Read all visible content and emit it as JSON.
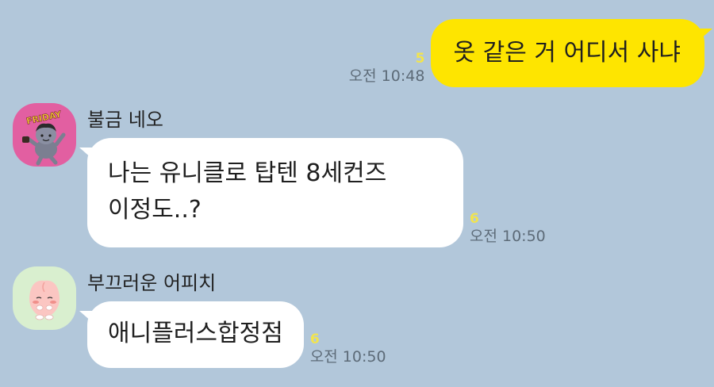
{
  "messages": [
    {
      "direction": "sent",
      "text": "옷 같은 거 어디서 사냐",
      "unread": "5",
      "time": "오전 10:48"
    },
    {
      "direction": "received",
      "sender": "불금 네오",
      "avatar": "neo-friday-avatar-icon",
      "lines": [
        "나는 유니클로 탑텐 8세컨즈",
        "이정도..?"
      ],
      "unread": "6",
      "time": "오전 10:50"
    },
    {
      "direction": "received",
      "sender": "부끄러운 어피치",
      "avatar": "apeach-avatar-icon",
      "text": "애니플러스합정점",
      "unread": "6",
      "time": "오전 10:50"
    }
  ],
  "avatar_labels": {
    "friday": "FRIDAY"
  },
  "colors": {
    "background": "#b2c7da",
    "sent_bubble": "#fee500",
    "received_bubble": "#ffffff",
    "unread": "#f2e44d",
    "time": "#5d6b78"
  }
}
